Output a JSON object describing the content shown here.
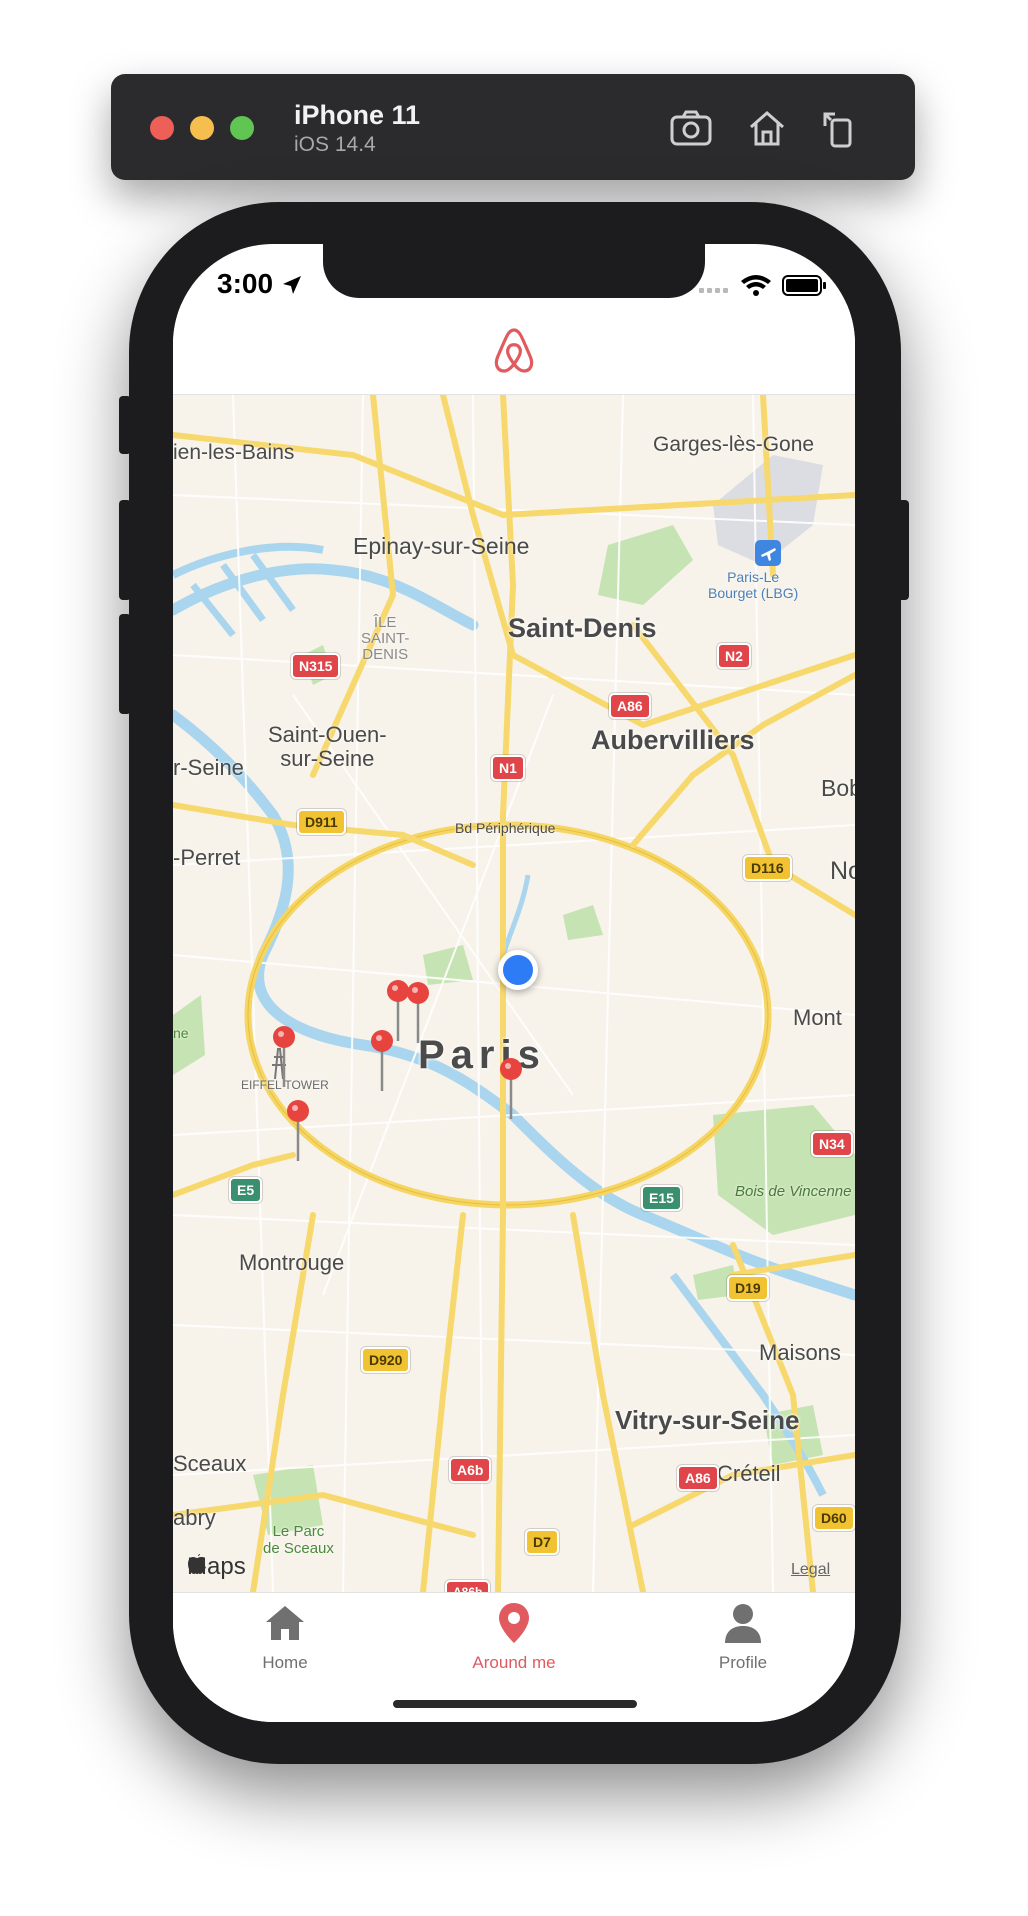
{
  "simulator": {
    "device": "iPhone 11",
    "os": "iOS 14.4",
    "icons": [
      "screenshot-icon",
      "home-icon",
      "rotate-icon"
    ]
  },
  "status_bar": {
    "time": "3:00"
  },
  "header": {
    "logo": "airbnb-logo-icon",
    "accent": "#e05a5f"
  },
  "map": {
    "places": {
      "enghien": "ien-les-Bains",
      "garges": "Garges-lès-Gone",
      "epinay": "Epinay-sur-Seine",
      "bourget": "Paris-Le\nBourget (LBG)",
      "ile_saint_denis": "ÎLE\nSAINT-\nDENIS",
      "saint_denis": "Saint-Denis",
      "saint_ouen": "Saint-Ouen-\nsur-Seine",
      "seine_left": "r-Seine",
      "aubervilliers": "Aubervilliers",
      "bob": "Bob",
      "perret": "-Perret",
      "periph": "Bd Périphérique",
      "paris": "Paris",
      "eiffel": "EIFFEL TOWER",
      "ne": "ne",
      "no": "No",
      "mont": "Mont",
      "bois": "Bois de Vincenne",
      "montrouge": "Montrouge",
      "maisons": "Maisons",
      "vitry": "Vitry-sur-Seine",
      "sceaux": "Sceaux",
      "creteil": "Créteil",
      "abry": "abry",
      "parc_sceaux": "Le Parc\nde Sceaux"
    },
    "shields": {
      "n315": "N315",
      "n2": "N2",
      "a86_top": "A86",
      "n1": "N1",
      "d911": "D911",
      "d116": "D116",
      "n34": "N34",
      "e5": "E5",
      "e15": "E15",
      "d19": "D19",
      "d920": "D920",
      "a6b": "A6b",
      "a86_bottom": "A86",
      "d60": "D60",
      "d7": "D7",
      "a86b": "A86b"
    },
    "attribution": "Maps",
    "legal": "Legal",
    "pin_color": "#e8443f",
    "user_location_color": "#2e7bf6"
  },
  "tabs": [
    {
      "label": "Home",
      "icon": "home-icon",
      "active": false
    },
    {
      "label": "Around me",
      "icon": "location-pin-icon",
      "active": true
    },
    {
      "label": "Profile",
      "icon": "person-icon",
      "active": false
    }
  ]
}
